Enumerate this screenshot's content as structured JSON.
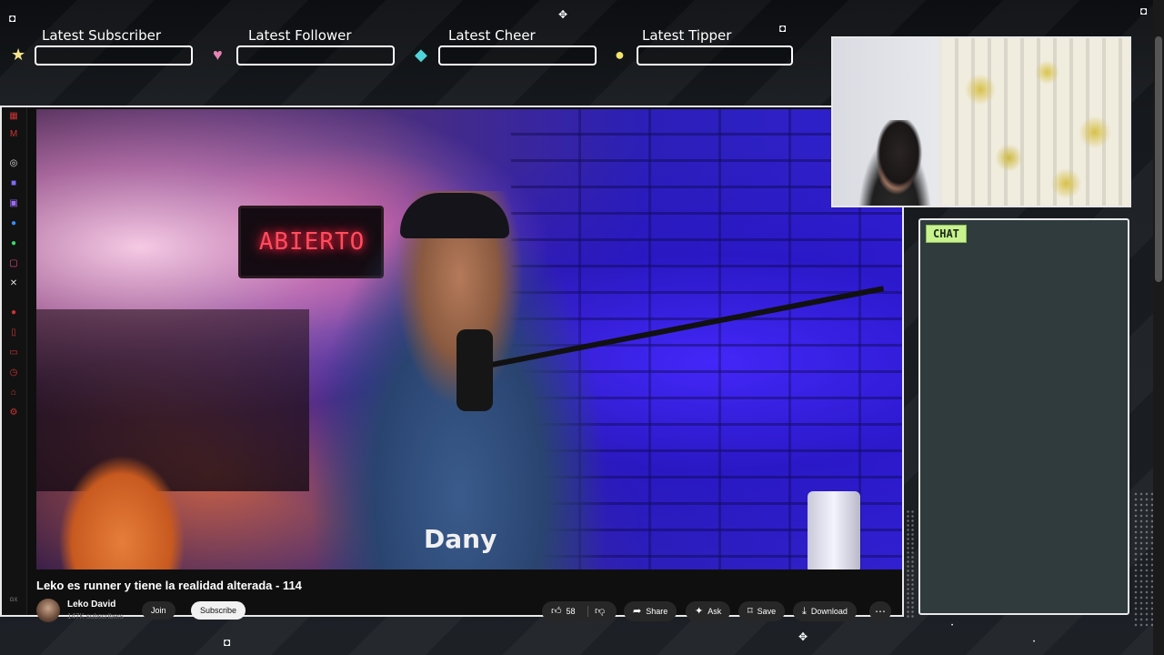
{
  "alerts": [
    {
      "label": "Latest Subscriber",
      "icon": "star-icon",
      "color": "#f2e38a"
    },
    {
      "label": "Latest Follower",
      "icon": "heart-icon",
      "color": "#e882b4"
    },
    {
      "label": "Latest Cheer",
      "icon": "gem-icon",
      "color": "#4fd3d9"
    },
    {
      "label": "Latest Tipper",
      "icon": "coin-icon",
      "color": "#f2e36a"
    }
  ],
  "video": {
    "sign_text": "ABIERTO",
    "shirt_text": "Dany",
    "title": "Leko es runner y tiene la realidad alterada - 114",
    "channel": {
      "name": "Leko David",
      "subscribers": "147K subscribers"
    },
    "join_label": "Join",
    "subscribe_label": "Subscribe",
    "like_count": "58",
    "actions": [
      {
        "label": "Share",
        "icon": "share-icon"
      },
      {
        "label": "Ask",
        "icon": "sparkle-icon"
      },
      {
        "label": "Save",
        "icon": "bookmark-icon"
      },
      {
        "label": "Download",
        "icon": "download-icon"
      }
    ],
    "more_label": "⋯"
  },
  "chat": {
    "badge": "CHAT"
  },
  "colors": {
    "background": "#1b1e22",
    "chat_bg": "#2f3b3d",
    "chat_badge": "#c8f28e",
    "youtube_red": "#ff0000"
  }
}
